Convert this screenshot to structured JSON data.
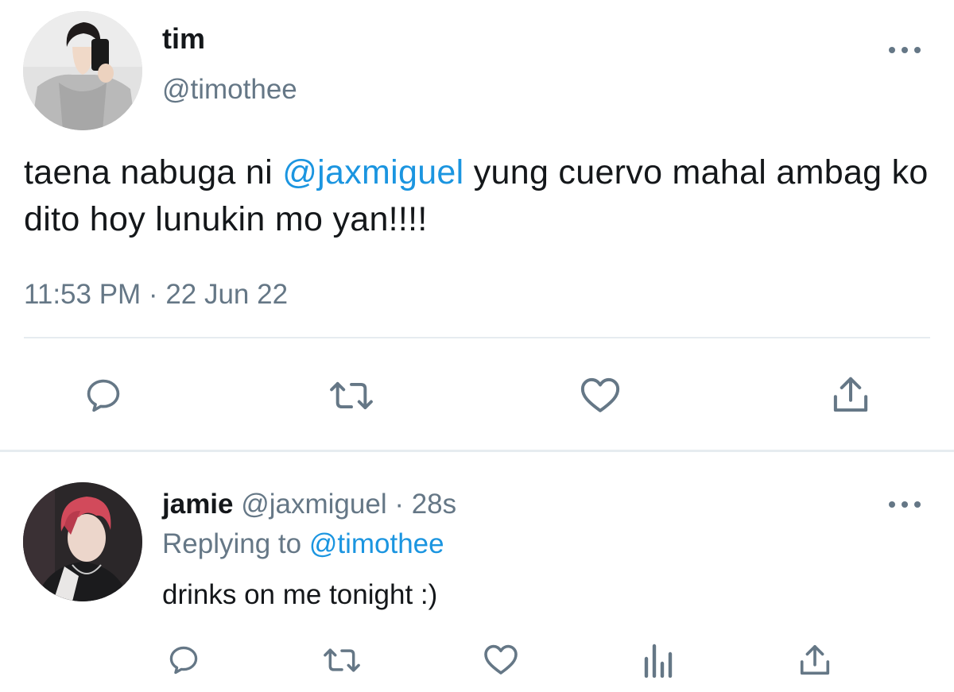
{
  "main_tweet": {
    "name": "tim",
    "handle": "@timothee",
    "text_parts": {
      "before": "taena nabuga ni ",
      "mention": "@jaxmiguel",
      "after": " yung cuervo mahal ambag ko dito hoy lunukin mo yan!!!!"
    },
    "timestamp": "11:53 PM · 22 Jun 22",
    "actions": [
      "reply-icon",
      "retweet-icon",
      "like-icon",
      "share-icon"
    ]
  },
  "reply_tweet": {
    "name": "jamie",
    "meta": " @jaxmiguel · 28s",
    "replying_prefix": "Replying to ",
    "replying_handle": "@timothee",
    "text": "drinks on me tonight :)",
    "actions": [
      "reply-icon",
      "retweet-icon",
      "like-icon",
      "analytics-icon",
      "share-icon"
    ]
  },
  "colors": {
    "text": "#14171a",
    "secondary": "#657786",
    "link": "#1b95e0",
    "divider": "#e6ecf0"
  }
}
